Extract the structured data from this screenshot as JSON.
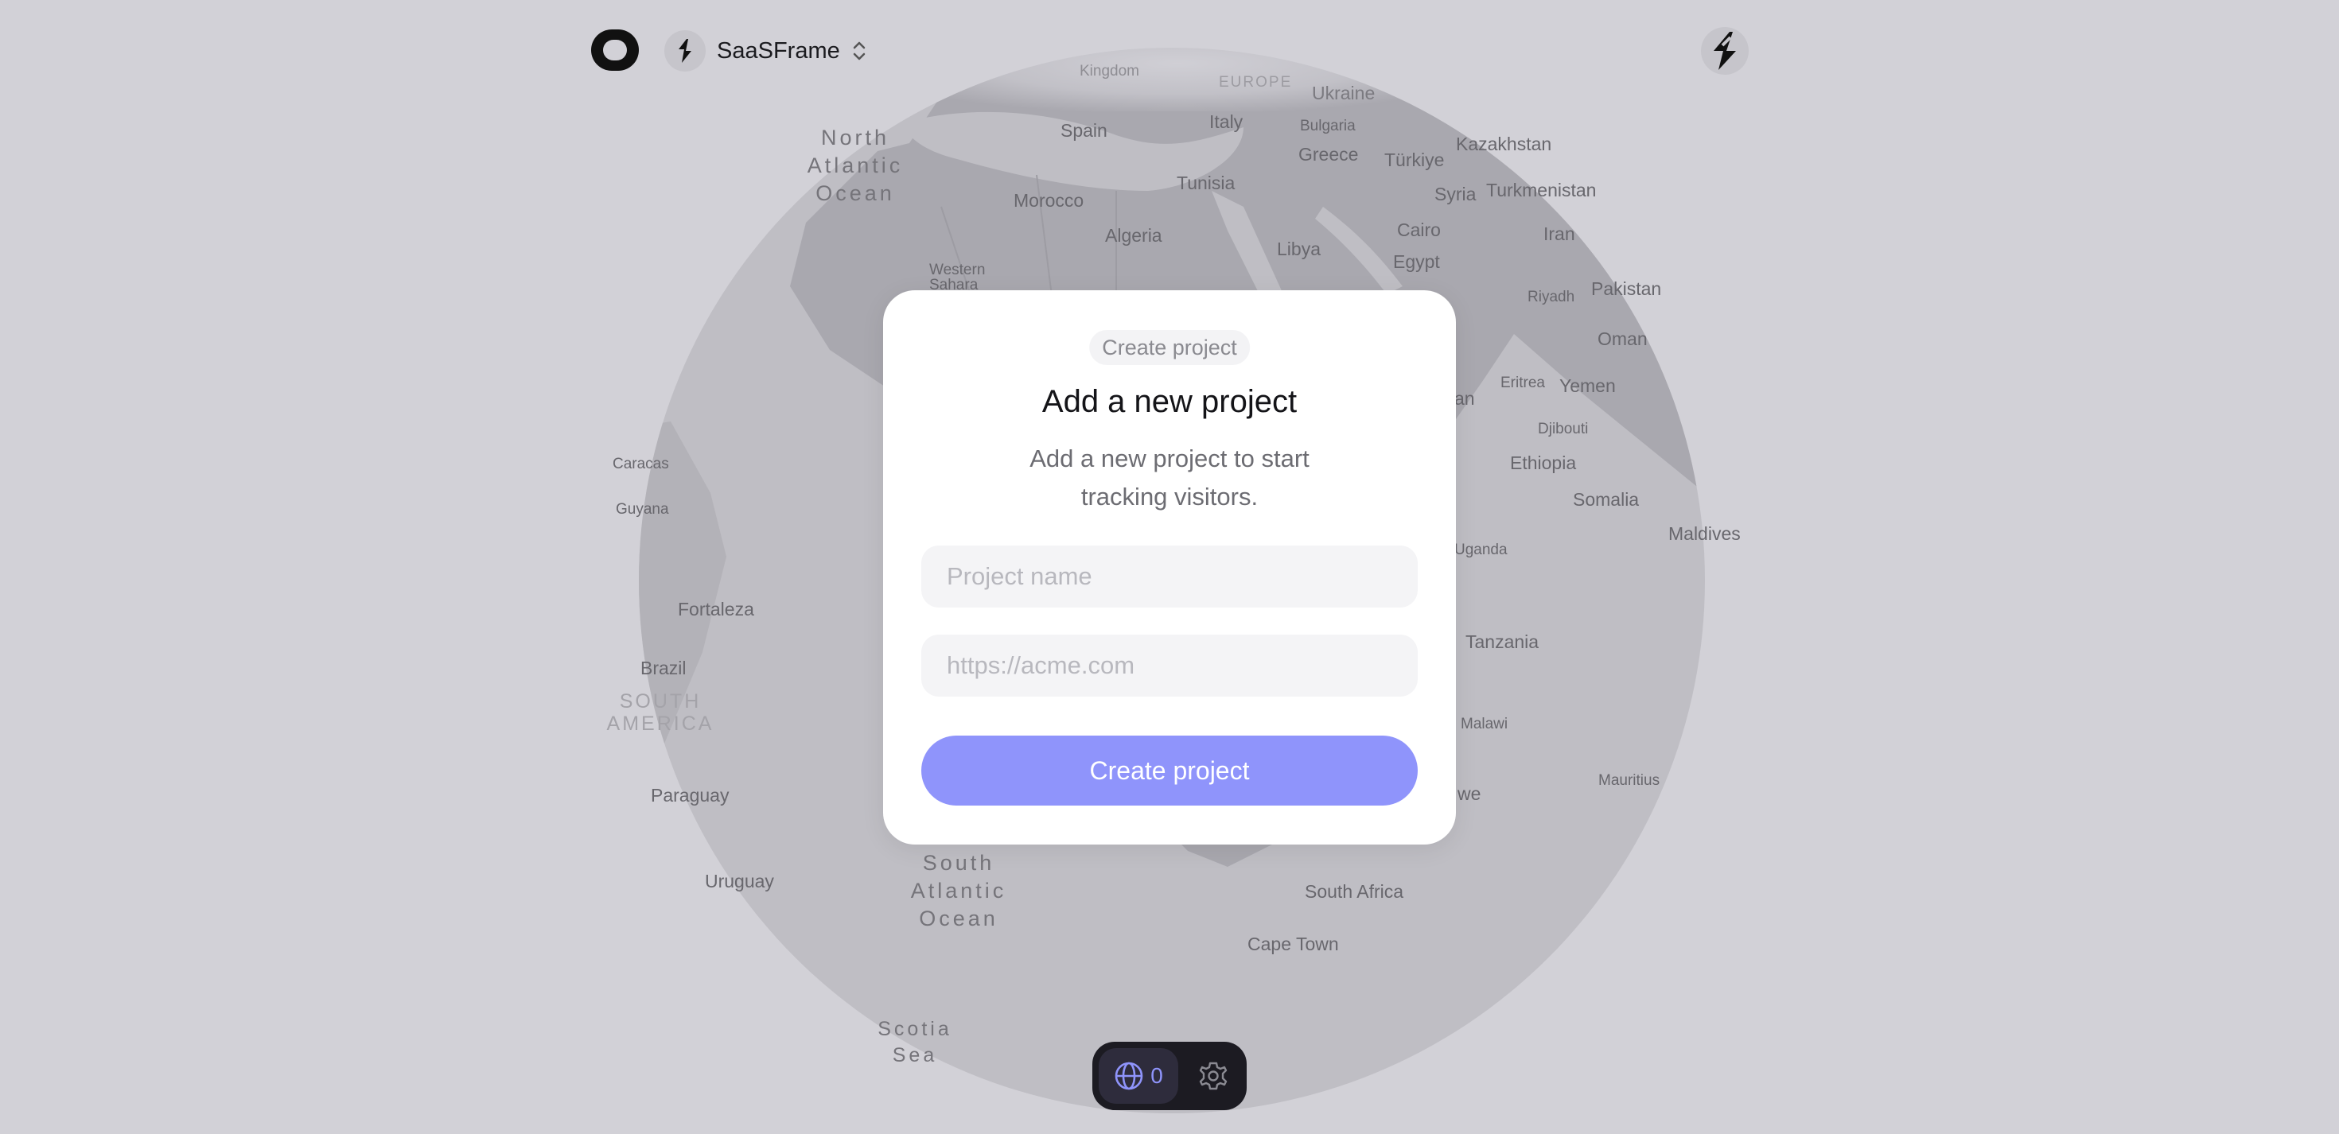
{
  "header": {
    "project_name": "SaaSFrame"
  },
  "modal": {
    "badge": "Create project",
    "title": "Add a new project",
    "description": "Add a new project to start tracking visitors.",
    "project_name_placeholder": "Project name",
    "url_placeholder": "https://acme.com",
    "submit_label": "Create project",
    "accent_color": "#8f94fb"
  },
  "dock": {
    "visitor_count": "0"
  },
  "map": {
    "labels": {
      "kingdom": "Kingdom",
      "europe": "EUROPE",
      "ukraine": "Ukraine",
      "spain": "Spain",
      "italy": "Italy",
      "bulgaria": "Bulgaria",
      "greece": "Greece",
      "turkiye": "Türkiye",
      "kazakhstan": "Kazakhstan",
      "north_atlantic": "North Atlantic Ocean",
      "morocco": "Morocco",
      "tunisia": "Tunisia",
      "syria": "Syria",
      "turkmenistan": "Turkmenistan",
      "algeria": "Algeria",
      "cairo": "Cairo",
      "iran": "Iran",
      "libya": "Libya",
      "egypt": "Egypt",
      "western_sahara": "Western Sahara",
      "riyadh": "Riyadh",
      "pakistan": "Pakistan",
      "oman": "Oman",
      "sudan_partial": "an",
      "eritrea": "Eritrea",
      "yemen": "Yemen",
      "djibouti": "Djibouti",
      "caracas": "Caracas",
      "ethiopia": "Ethiopia",
      "guyana": "Guyana",
      "somalia": "Somalia",
      "maldives": "Maldives",
      "uganda": "Uganda",
      "fortaleza": "Fortaleza",
      "tanzania": "Tanzania",
      "brazil": "Brazil",
      "south_america": "SOUTH AMERICA",
      "malawi": "Malawi",
      "mauritius": "Mauritius",
      "zimbabwe_partial": "we",
      "paraguay": "Paraguay",
      "south_atlantic": "South Atlantic Ocean",
      "uruguay": "Uruguay",
      "south_africa": "South Africa",
      "cape_town": "Cape Town",
      "scotia_sea": "Scotia Sea"
    }
  }
}
